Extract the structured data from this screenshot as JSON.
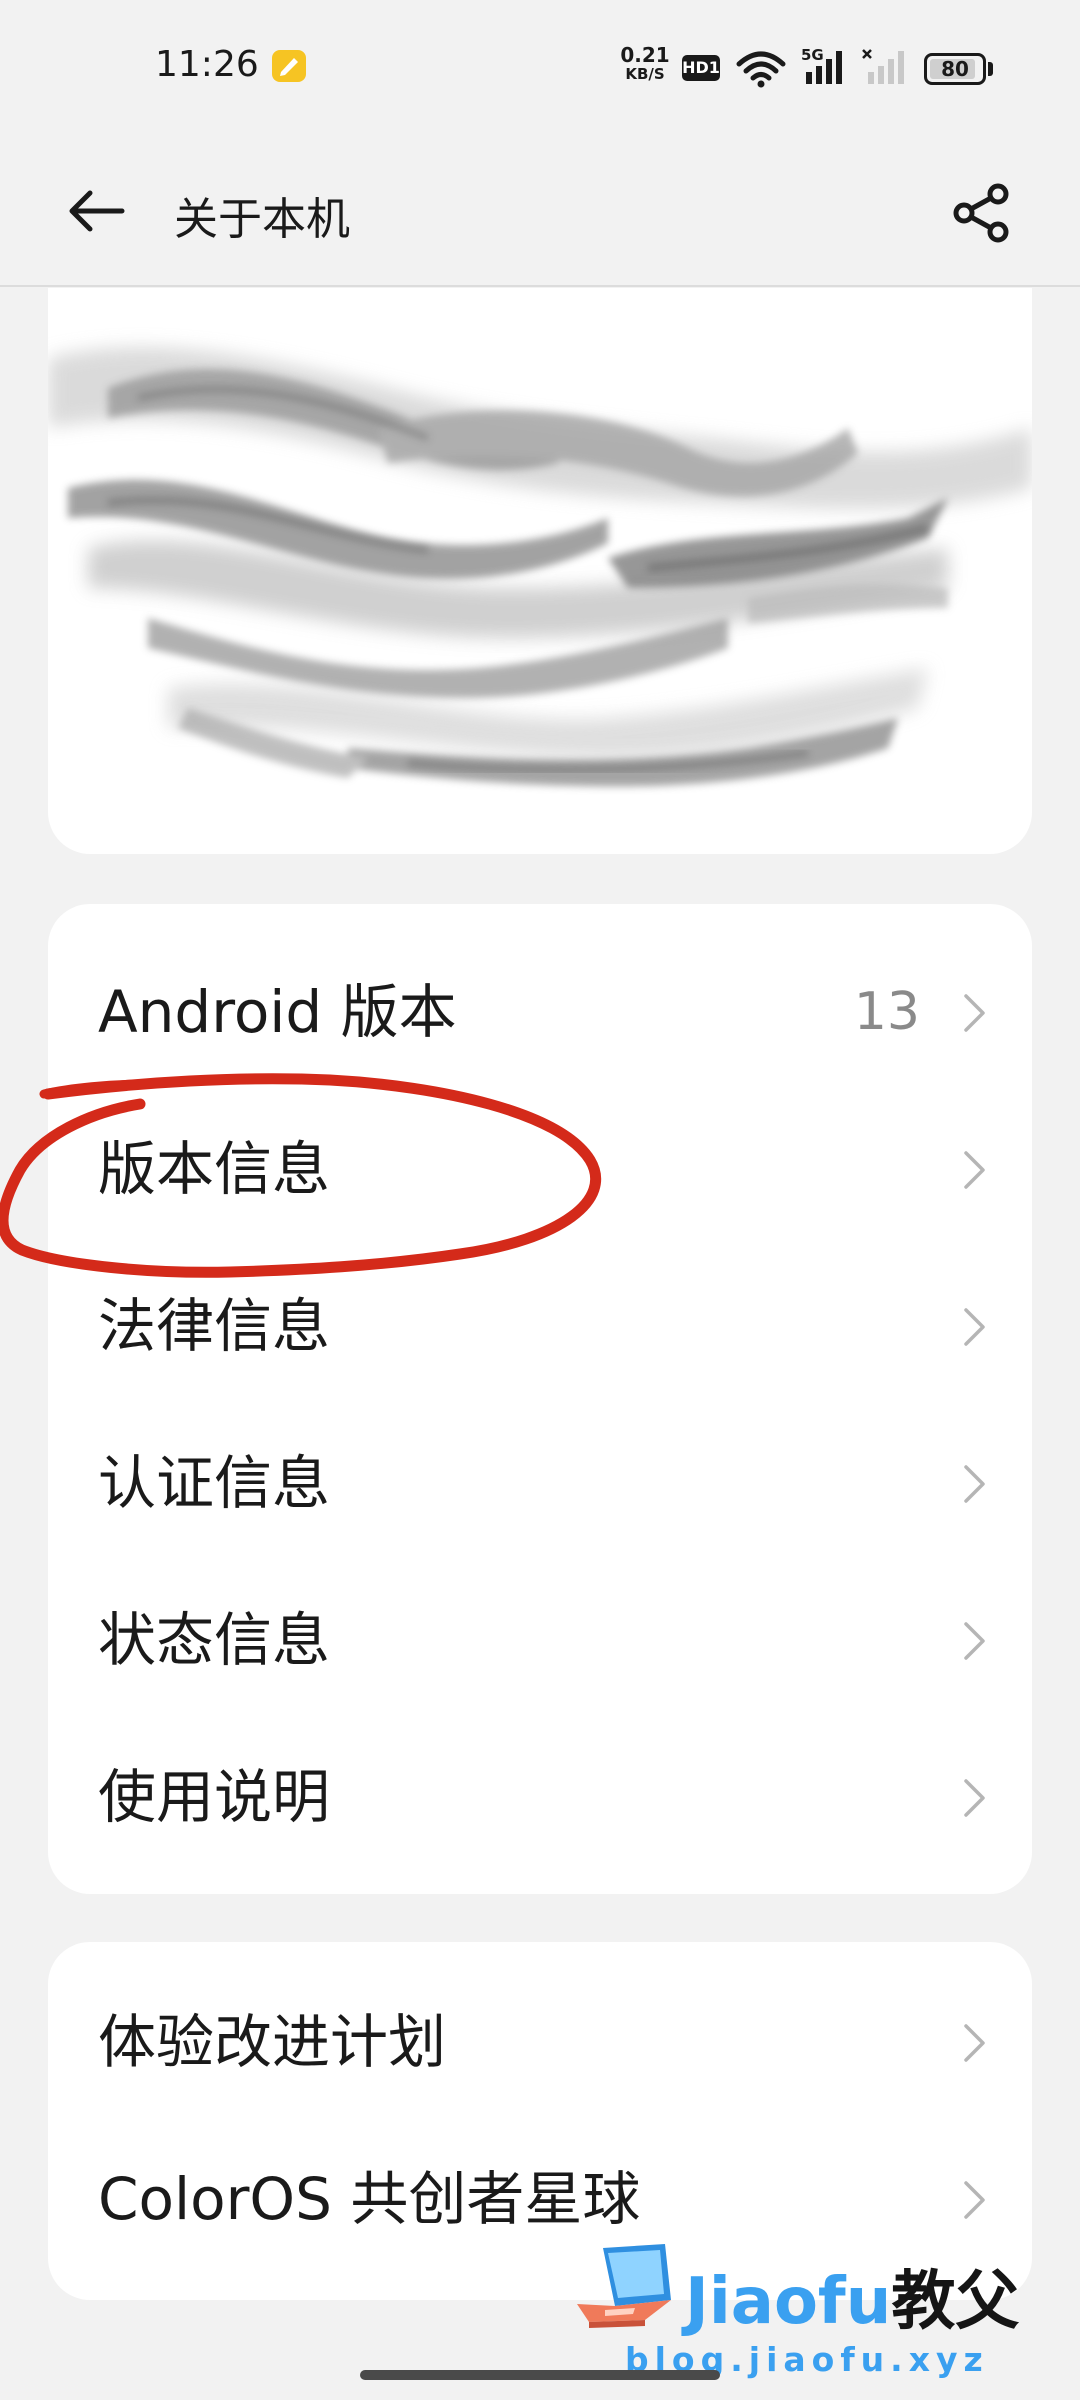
{
  "status_bar": {
    "time": "11:26",
    "net_speed_value": "0.21",
    "net_speed_unit": "KB/S",
    "hd_label": "HD1",
    "sig1_label": "5G",
    "battery": "80"
  },
  "app_bar": {
    "title": "关于本机"
  },
  "info_section": {
    "items": [
      {
        "label": "Android 版本",
        "value": "13"
      },
      {
        "label": "版本信息"
      },
      {
        "label": "法律信息"
      },
      {
        "label": "认证信息"
      },
      {
        "label": "状态信息"
      },
      {
        "label": "使用说明"
      }
    ]
  },
  "extra_section": {
    "items": [
      {
        "label": "体验改进计划"
      },
      {
        "label": "ColorOS 共创者星球"
      }
    ]
  },
  "watermark": {
    "brand_latin": "Jiaofu",
    "brand_cn": "教父",
    "url": "blog.jiaofu.xyz"
  },
  "colors": {
    "background": "#f2f2f2",
    "card": "#ffffff",
    "annotation": "#d42a1a",
    "watermark_blue": "#3aa0f0"
  }
}
